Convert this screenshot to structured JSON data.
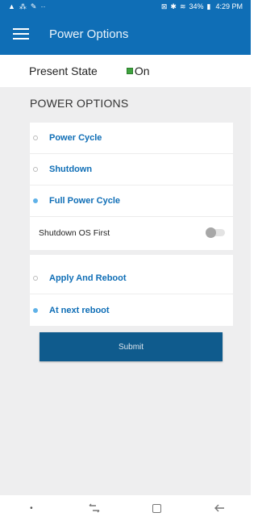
{
  "status_bar": {
    "left_icons": [
      "notification-icon",
      "signal-icon",
      "pen-icon"
    ],
    "left_extra": "··",
    "battery": "34%",
    "time": "4:29 PM"
  },
  "app_bar": {
    "title": "Power Options"
  },
  "present_state": {
    "label": "Present State",
    "value": "On",
    "indicator_color": "#3fa33f"
  },
  "section": {
    "title": "POWER OPTIONS"
  },
  "options_group1": [
    {
      "label": "Power Cycle",
      "selected": false
    },
    {
      "label": "Shutdown",
      "selected": false
    },
    {
      "label": "Full Power Cycle",
      "selected": true
    }
  ],
  "shutdown_toggle": {
    "label": "Shutdown OS First",
    "on": false
  },
  "options_group2": [
    {
      "label": "Apply And Reboot",
      "selected": false
    },
    {
      "label": "At next reboot",
      "selected": true
    }
  ],
  "submit": {
    "label": "Submit"
  },
  "nav_bar": {
    "items": [
      "dot-icon",
      "recent-apps-icon",
      "home-icon",
      "back-icon"
    ]
  },
  "colors": {
    "primary": "#0f6eb6",
    "button": "#0f5b8d",
    "radio_selected": "#60b2e8",
    "background": "#eeeeef"
  }
}
